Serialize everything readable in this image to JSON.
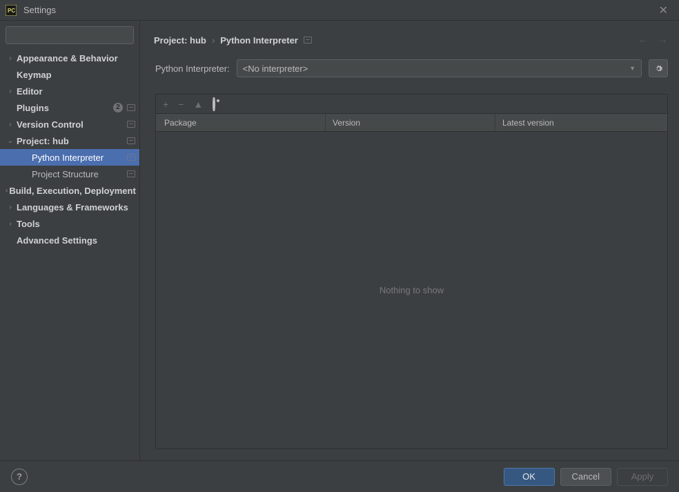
{
  "title": "Settings",
  "search_placeholder": "",
  "sidebar": {
    "items": [
      {
        "label": "Appearance & Behavior",
        "chevron": "right",
        "bold": true,
        "indent": 1
      },
      {
        "label": "Keymap",
        "chevron": "",
        "bold": true,
        "indent": 1
      },
      {
        "label": "Editor",
        "chevron": "right",
        "bold": true,
        "indent": 1
      },
      {
        "label": "Plugins",
        "chevron": "",
        "bold": true,
        "indent": 1,
        "badge": "2",
        "ext": true
      },
      {
        "label": "Version Control",
        "chevron": "right",
        "bold": true,
        "indent": 1,
        "ext": true
      },
      {
        "label": "Project: hub",
        "chevron": "down",
        "bold": true,
        "indent": 1,
        "ext": true
      },
      {
        "label": "Python Interpreter",
        "chevron": "",
        "bold": false,
        "indent": 2,
        "ext": true,
        "selected": true
      },
      {
        "label": "Project Structure",
        "chevron": "",
        "bold": false,
        "indent": 2,
        "ext": true
      },
      {
        "label": "Build, Execution, Deployment",
        "chevron": "right",
        "bold": true,
        "indent": 1
      },
      {
        "label": "Languages & Frameworks",
        "chevron": "right",
        "bold": true,
        "indent": 1
      },
      {
        "label": "Tools",
        "chevron": "right",
        "bold": true,
        "indent": 1
      },
      {
        "label": "Advanced Settings",
        "chevron": "",
        "bold": true,
        "indent": 1
      }
    ]
  },
  "breadcrumbs": {
    "b1": "Project: hub",
    "b2": "Python Interpreter"
  },
  "interpreter": {
    "label": "Python Interpreter:",
    "value": "<No interpreter>"
  },
  "packages": {
    "col1": "Package",
    "col2": "Version",
    "col3": "Latest version",
    "empty": "Nothing to show"
  },
  "buttons": {
    "ok": "OK",
    "cancel": "Cancel",
    "apply": "Apply"
  }
}
